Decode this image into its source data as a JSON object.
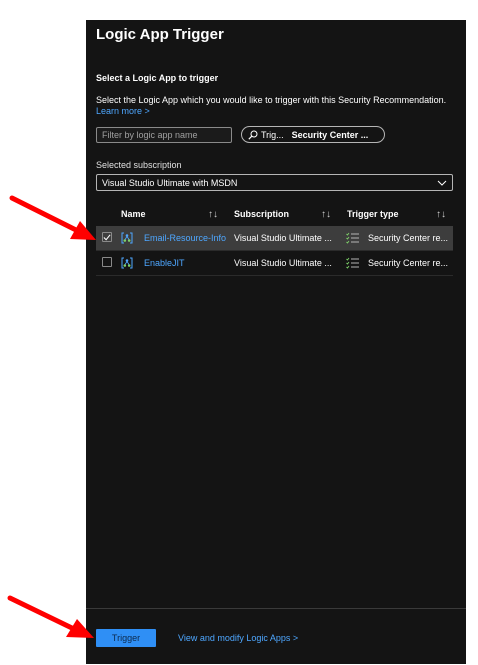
{
  "panel": {
    "title": "Logic App Trigger",
    "section_heading": "Select a Logic App to trigger",
    "description": "Select the Logic App which you would like to trigger with this Security Recommendation.",
    "learn_more": "Learn more >"
  },
  "filters": {
    "search_placeholder": "Filter by logic app name",
    "pill_label": "Trig...",
    "pill_value": "Security Center ..."
  },
  "subscription": {
    "label": "Selected subscription",
    "value": "Visual Studio Ultimate with MSDN"
  },
  "table": {
    "columns": [
      "Name",
      "Subscription",
      "Trigger type"
    ],
    "sort_glyph": "↑↓",
    "rows": [
      {
        "name": "Email-Resource-Info",
        "subscription": "Visual Studio Ultimate ...",
        "trigger_type": "Security Center re...",
        "selected": true
      },
      {
        "name": "EnableJIT",
        "subscription": "Visual Studio Ultimate ...",
        "trigger_type": "Security Center re...",
        "selected": false
      }
    ]
  },
  "footer": {
    "trigger_button": "Trigger",
    "modify_link": "View and modify Logic Apps >"
  },
  "colors": {
    "panel_bg": "#141414",
    "link": "#4ea7ff",
    "primary_button": "#2f8ff5",
    "selected_row": "#3d3d3d",
    "annotation_arrow": "#ff0000"
  },
  "icons": {
    "search": "search-icon",
    "dropdown": "chevron-down-icon",
    "logic_app": "logic-app-icon",
    "trigger_type": "checklist-icon",
    "checkbox_checked": "checkmark-icon"
  }
}
